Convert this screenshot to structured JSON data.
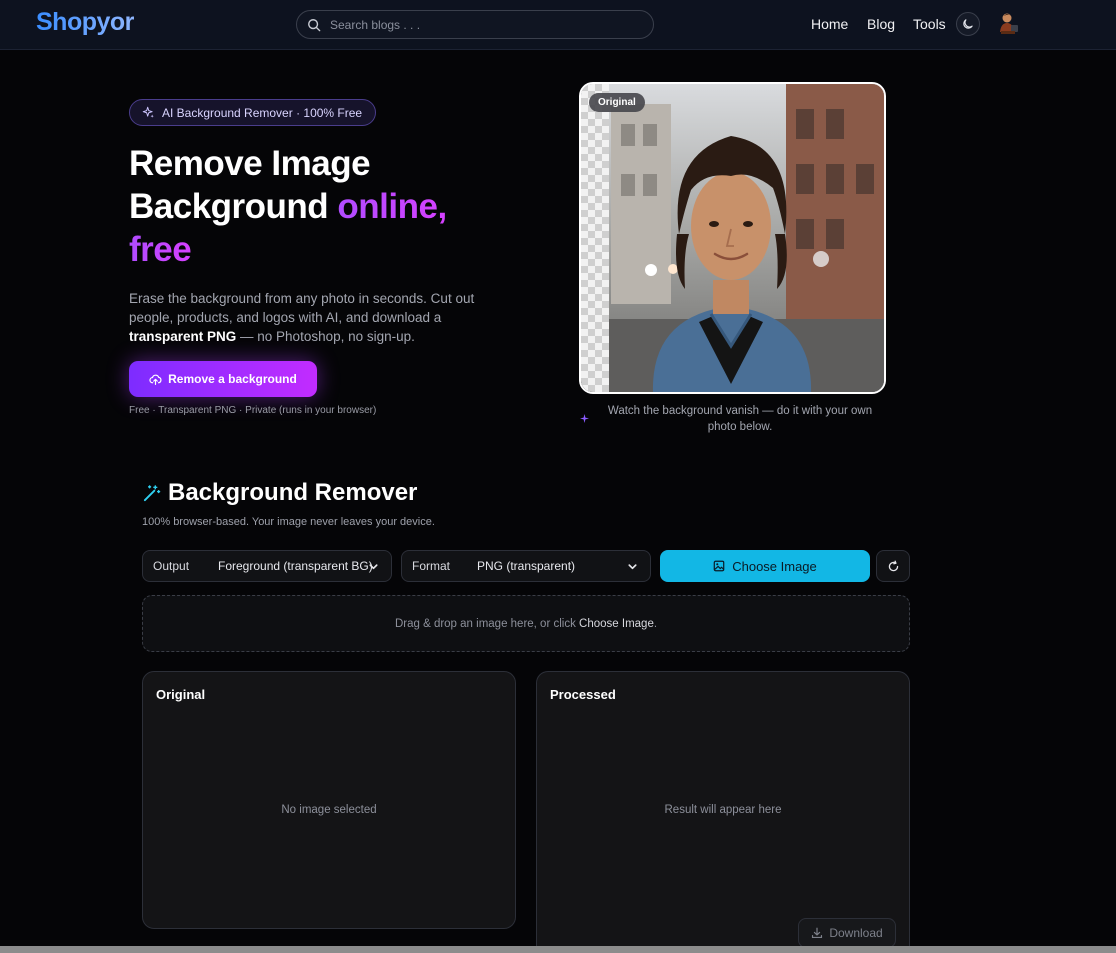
{
  "header": {
    "logo": "Shopyor",
    "search_placeholder": "Search blogs . . .",
    "nav": {
      "home": "Home",
      "blog": "Blog",
      "tools": "Tools"
    }
  },
  "hero": {
    "badge": "AI Background Remover · 100% Free",
    "title_line1": "Remove Image",
    "title_line2_plain": "Background ",
    "title_line2_accent": "online,",
    "title_line3_accent": "free",
    "desc_prefix": "Erase the background from any photo in seconds. Cut out people, products, and logos with AI, and download a ",
    "desc_bold": "transparent PNG",
    "desc_suffix": " — no Photoshop, no sign-up.",
    "cta_label": "Remove a background",
    "note": "Free · Transparent PNG · Private (runs in your browser)",
    "image_tag": "Original",
    "image_caption": "Watch the background vanish — do it with your own photo below."
  },
  "tool": {
    "title": "Background Remover",
    "subtitle": "100% browser-based. Your image never leaves your device.",
    "output_label": "Output",
    "output_value": "Foreground (transparent BG)",
    "format_label": "Format",
    "format_value": "PNG (transparent)",
    "choose_label": "Choose Image",
    "drop_prefix": "Drag & drop an image here, or click ",
    "drop_strong": "Choose Image",
    "drop_suffix": ".",
    "original_title": "Original",
    "original_empty": "No image selected",
    "processed_title": "Processed",
    "processed_empty": "Result will appear here",
    "download_label": "Download"
  },
  "icons": {
    "search": "search-icon",
    "theme": "moon-icon",
    "sparkle": "sparkle-icon",
    "upload": "cloud-upload-icon",
    "wand": "magic-wand-icon",
    "image": "image-icon",
    "reset": "refresh-icon",
    "download": "download-icon",
    "chevron": "chevron-down-icon"
  },
  "colors": {
    "accent_purple": "#b04cff",
    "cta_gradient_start": "#7d2cff",
    "cta_gradient_end": "#c22cff",
    "choose_button": "#12b7e5",
    "logo_blue": "#3a8dff",
    "background": "#050507"
  }
}
